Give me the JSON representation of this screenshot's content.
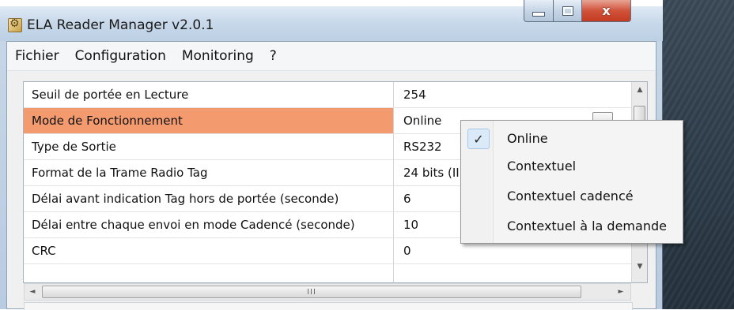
{
  "window": {
    "title": "ELA Reader Manager v2.0.1",
    "caption_close": "x"
  },
  "menubar": {
    "items": [
      "Fichier",
      "Configuration",
      "Monitoring",
      "?"
    ]
  },
  "grid": {
    "rows": [
      {
        "name": "Seuil de portée en Lecture",
        "value": "254"
      },
      {
        "name": "Mode de Fonctionnement",
        "value": "Online",
        "selected": true
      },
      {
        "name": "Type de Sortie",
        "value": "RS232"
      },
      {
        "name": "Format de la Trame Radio Tag",
        "value": "24 bits (II"
      },
      {
        "name": "Délai avant indication Tag hors de portée (seconde)",
        "value": "6"
      },
      {
        "name": "Délai entre chaque envoi en mode Cadencé (seconde)",
        "value": "10"
      },
      {
        "name": "CRC",
        "value": "0"
      }
    ],
    "selected_color": "#f49a6f"
  },
  "scrollbars": {
    "up_arrow": "▲",
    "down_arrow": "▼",
    "left_arrow": "◄",
    "right_arrow": "►",
    "h_grip": "III"
  },
  "dropdown": {
    "options": [
      "Online",
      "Contextuel",
      "Contextuel cadencé",
      "Contextuel à la demande"
    ],
    "checked_index": 0,
    "check_glyph": "✓"
  },
  "colors": {
    "accent": "#f49a6f",
    "titlebar": "#c7d8ea",
    "close_button": "#c43b22"
  }
}
